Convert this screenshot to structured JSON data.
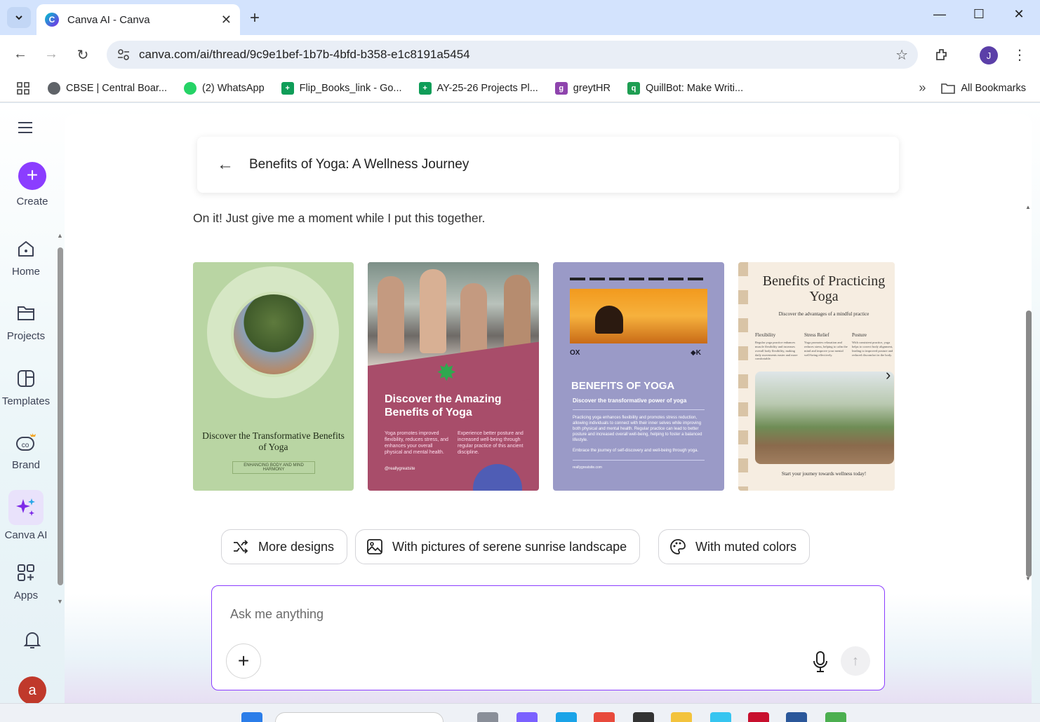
{
  "browser": {
    "tab_title": "Canva AI - Canva",
    "url": "canva.com/ai/thread/9c9e1bef-1b7b-4bfd-b358-e1c8191a5454",
    "profile_initial": "J",
    "bookmarks": [
      {
        "label": "CBSE | Central Boar...",
        "icon": "globe-icon",
        "color": "#5f6368"
      },
      {
        "label": "(2) WhatsApp",
        "icon": "whatsapp-icon",
        "color": "#25d366"
      },
      {
        "label": "Flip_Books_link - Go...",
        "icon": "sheets-icon",
        "color": "#0f9d58"
      },
      {
        "label": "AY-25-26 Projects Pl...",
        "icon": "sheets-icon",
        "color": "#0f9d58"
      },
      {
        "label": "greytHR",
        "icon": "greythr-icon",
        "color": "#8e44ad"
      },
      {
        "label": "QuillBot: Make Writi...",
        "icon": "quillbot-icon",
        "color": "#1e9e52"
      }
    ],
    "all_bookmarks": "All Bookmarks"
  },
  "sidebar": {
    "create": "Create",
    "items": [
      {
        "label": "Home",
        "icon": "home-icon"
      },
      {
        "label": "Projects",
        "icon": "folder-icon"
      },
      {
        "label": "Templates",
        "icon": "templates-icon"
      },
      {
        "label": "Brand",
        "icon": "brand-icon"
      },
      {
        "label": "Canva AI",
        "icon": "sparkle-icon"
      },
      {
        "label": "Apps",
        "icon": "apps-icon"
      }
    ],
    "avatar_initial": "a"
  },
  "thread": {
    "title": "Benefits of Yoga: A Wellness Journey",
    "message": "On it! Just give me a moment while I put this together."
  },
  "designs": [
    {
      "title": "Discover the Transformative Benefits of Yoga",
      "subtitle": "ENHANCING BODY AND MIND HARMONY"
    },
    {
      "title": "Discover the Amazing Benefits of Yoga",
      "col1": "Yoga promotes improved flexibility, reduces stress, and enhances your overall physical and mental health.",
      "col2": "Experience better posture and increased well-being through regular practice of this ancient discipline.",
      "handle": "@reallygreatsite"
    },
    {
      "title": "BENEFITS OF YOGA",
      "subtitle": "Discover the transformative power of yoga",
      "body": "Practicing yoga enhances flexibility and promotes stress reduction, allowing individuals to connect with their inner selves while improving both physical and mental health. Regular practice can lead to better posture and increased overall well-being, helping to foster a balanced lifestyle.",
      "emphasis": "Embrace the journey of self-discovery and well-being through yoga.",
      "website": "reallygreatsite.com",
      "logo_left": "OX",
      "logo_right": "◆K"
    },
    {
      "title": "Benefits of Practicing Yoga",
      "subtitle": "Discover the advantages of a mindful practice",
      "columns": [
        {
          "head": "Flexibility",
          "body": "Regular yoga practice enhances muscle flexibility and increases overall body flexibility, making daily movements easier and more comfortable."
        },
        {
          "head": "Stress Relief",
          "body": "Yoga promotes relaxation and reduces stress, helping to calm the mind and improve your mental well-being effectively."
        },
        {
          "head": "Posture",
          "body": "With consistent practice, yoga helps to correct body alignment, leading to improved posture and reduced discomfort in the body."
        }
      ],
      "footer": "Start your journey towards wellness today!"
    }
  ],
  "suggestions": [
    {
      "label": "More designs",
      "icon": "shuffle-icon"
    },
    {
      "label": "With pictures of serene sunrise landscape",
      "icon": "image-icon"
    },
    {
      "label": "With muted colors",
      "icon": "palette-icon"
    }
  ],
  "input": {
    "placeholder": "Ask me anything"
  },
  "colors": {
    "accent": "#8b3dff"
  }
}
